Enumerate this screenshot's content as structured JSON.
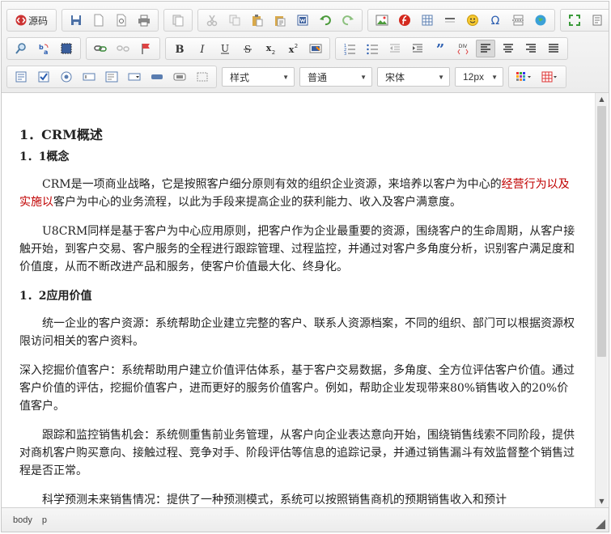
{
  "toolbar": {
    "source_label": "源码",
    "style_select": "样式",
    "format_select": "普通",
    "font_select": "宋体",
    "size_select": "12px"
  },
  "content": {
    "h1": "1．CRM概述",
    "h2_concept": "1．1概念",
    "p1_a": "CRM是一项商业战略，它是按照客户细分原则有效的组织企业资源，来培养以客户为中心的",
    "p1_red": "经营行为以及实施以",
    "p1_b": "客户为中心的业务流程，以此为手段来提高企业的获利能力、收入及客户满意度。",
    "p2": "U8CRM同样是基于客户为中心应用原则，把客户作为企业最重要的资源，围绕客户的生命周期，从客户接触开始，到客户交易、客户服务的全程进行跟踪管理、过程监控，并通过对客户多角度分析，识别客户满足度和价值度，从而不断改进产品和服务，使客户价值最大化、终身化。",
    "h2_value": "1．2应用价值",
    "p3": "统一企业的客户资源：系统帮助企业建立完整的客户、联系人资源档案，不同的组织、部门可以根据资源权限访问相关的客户资料。",
    "p4": "深入挖掘价值客户：系统帮助用户建立价值评估体系，基于客户交易数据，多角度、全方位评估客户价值。通过客户价值的评估，挖掘价值客户，进而更好的服务价值客户。例如，帮助企业发现带来80%销售收入的20%价值客户。",
    "p5": "跟踪和监控销售机会：系统侧重售前业务管理，从客户向企业表达意向开始，围绕销售线索不同阶段，提供对商机客户购买意向、接触过程、竞争对手、阶段评估等信息的追踪记录，并通过销售漏斗有效监督整个销售过程是否正常。",
    "p6": "科学预测未来销售情况：提供了一种预测模式，系统可以按照销售商机的预期销售收入和预计"
  },
  "statusbar": {
    "path_body": "body",
    "path_p": "p"
  },
  "colors": {
    "accent_red": "#c00000",
    "text": "#222222"
  },
  "icons": [
    "source-icon",
    "save-icon",
    "new-doc-icon",
    "preview-icon",
    "print-icon",
    "template-icon",
    "cut-icon",
    "copy-icon",
    "paste-icon",
    "paste-text-icon",
    "paste-word-icon",
    "undo-icon",
    "redo-icon",
    "image-icon",
    "flash-icon",
    "table-icon",
    "hr-icon",
    "emoticon-icon",
    "special-char-icon",
    "pagebreak-icon",
    "map-icon",
    "maximize-icon",
    "show-blocks-icon",
    "find-icon",
    "replace-icon",
    "select-all-icon",
    "link-icon",
    "unlink-icon",
    "anchor-icon",
    "bold-icon",
    "italic-icon",
    "underline-icon",
    "strikethrough-icon",
    "subscript-icon",
    "superscript-icon",
    "remove-format-icon",
    "ordered-list-icon",
    "unordered-list-icon",
    "outdent-icon",
    "indent-icon",
    "blockquote-icon",
    "div-icon",
    "align-left-icon",
    "align-center-icon",
    "align-right-icon",
    "align-justify-icon",
    "form-icon",
    "checkbox-icon",
    "radio-icon",
    "textfield-icon",
    "textarea-icon",
    "select-icon",
    "button-icon",
    "imagebutton-icon",
    "hiddenfield-icon",
    "text-color-icon",
    "bg-color-icon"
  ]
}
